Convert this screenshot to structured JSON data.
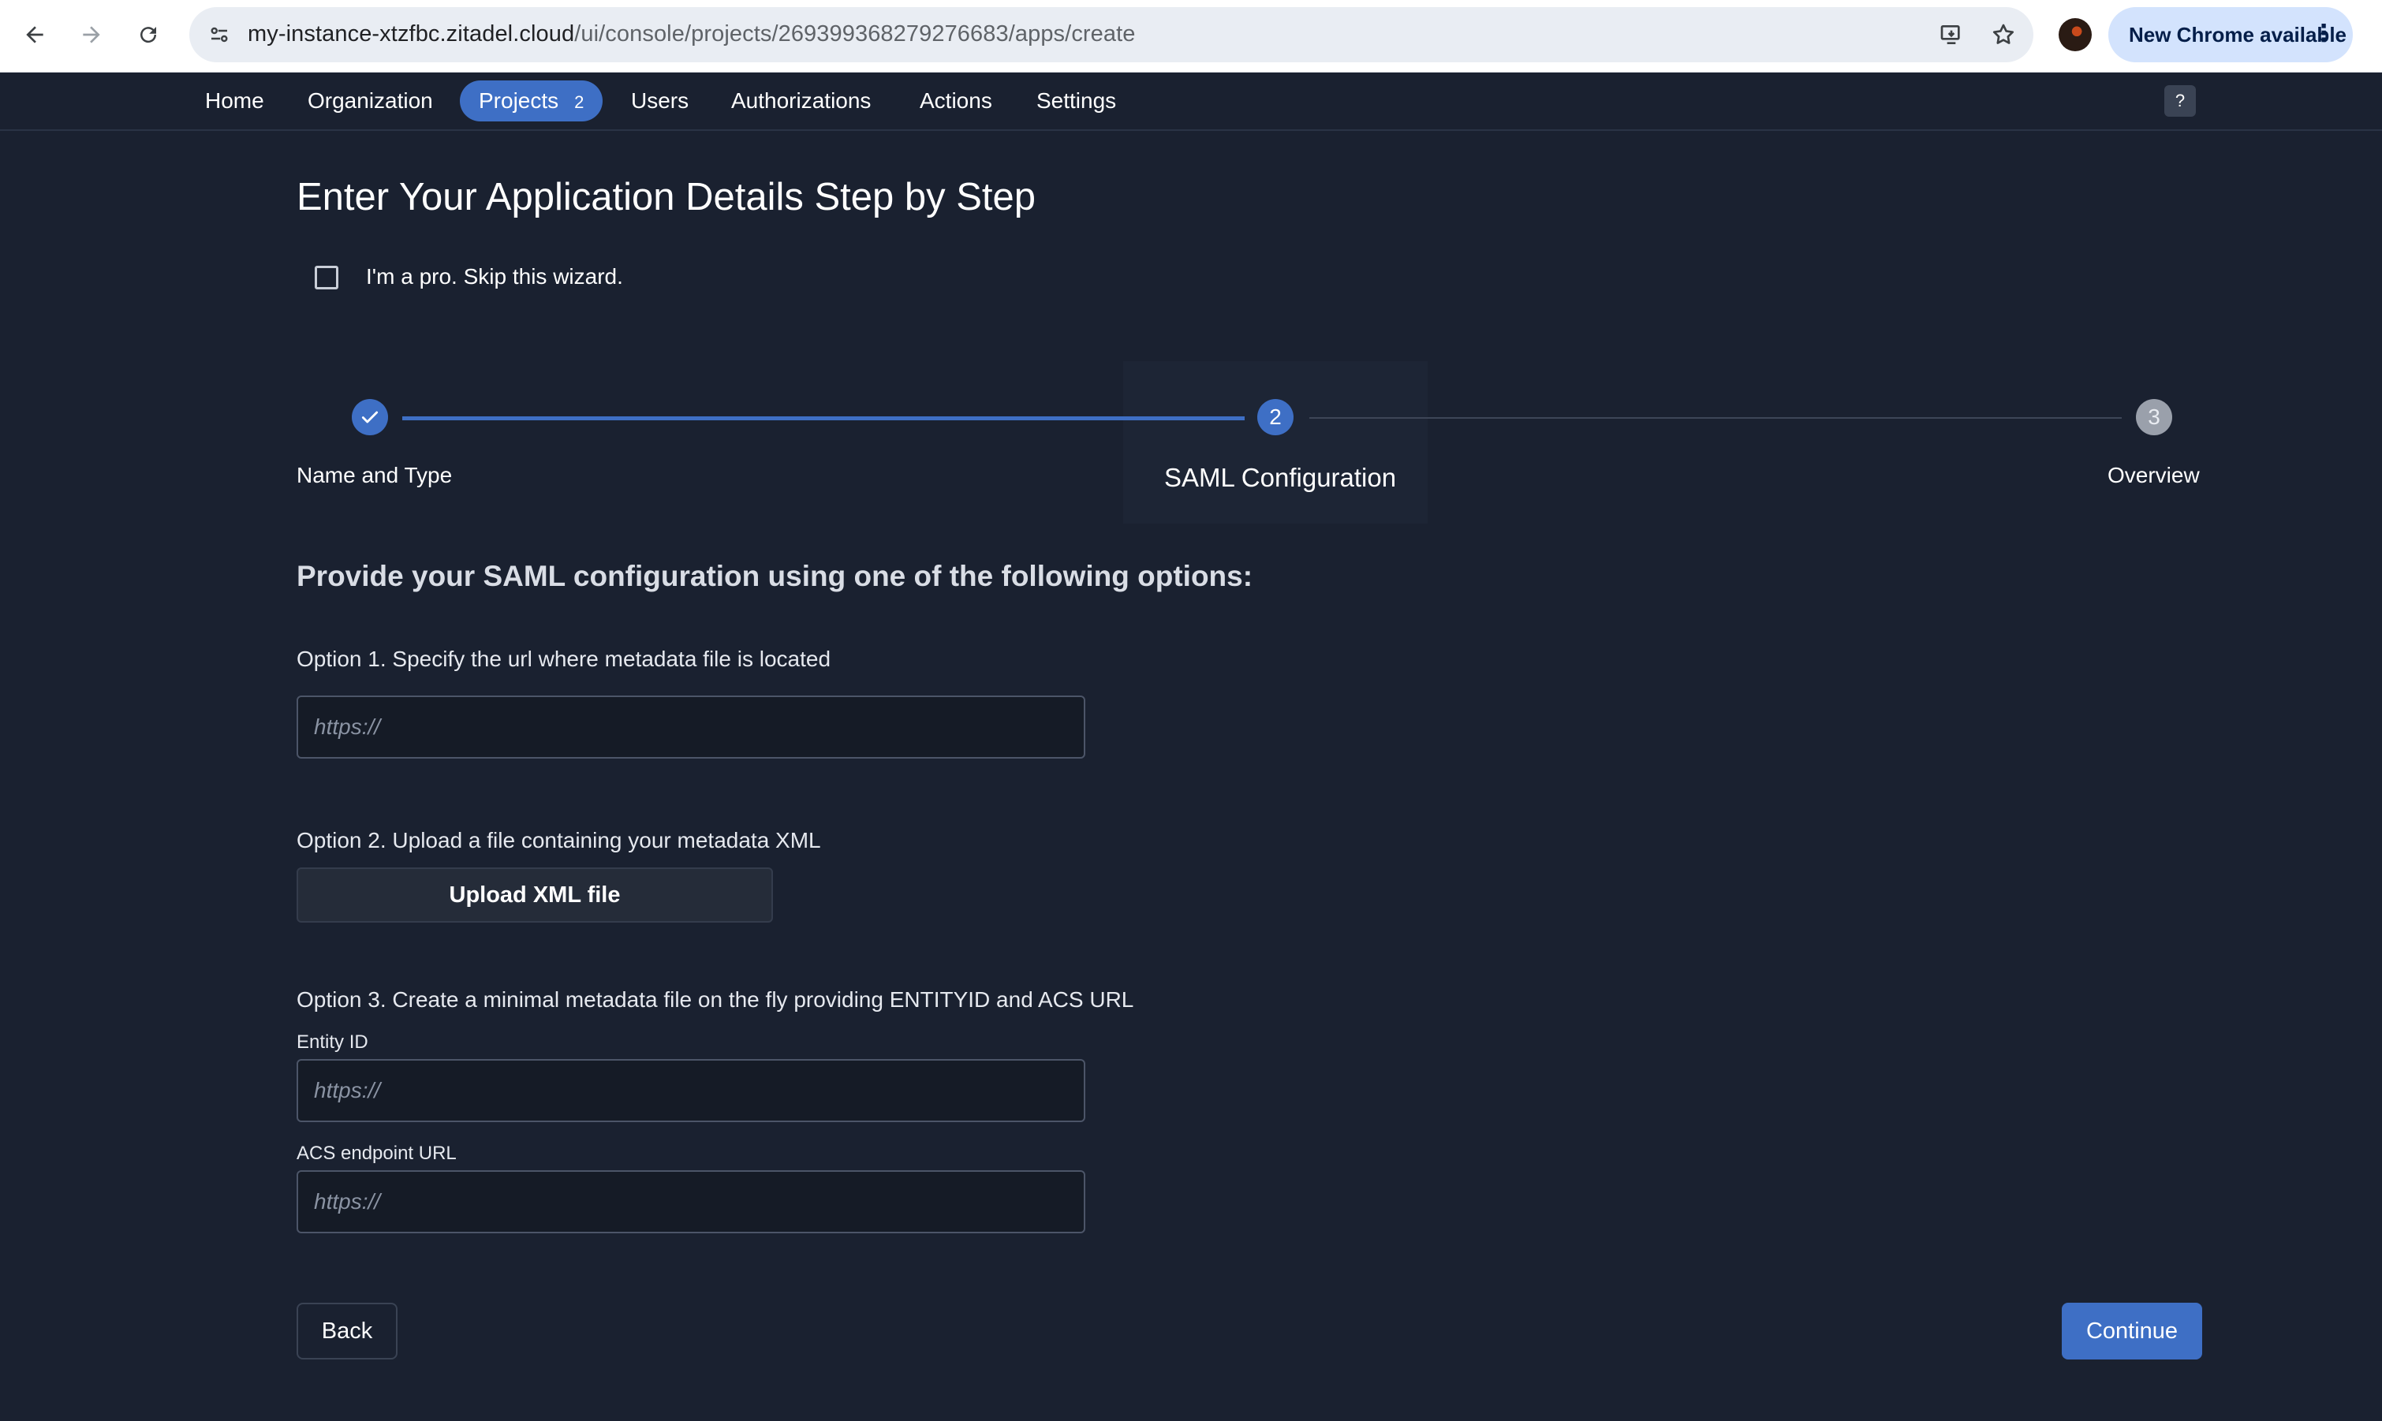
{
  "browser": {
    "url_host": "my-instance-xtzfbc.zitadel.cloud",
    "url_path": "/ui/console/projects/269399368279276683/apps/create",
    "update_label": "New Chrome available"
  },
  "nav": {
    "items": [
      "Home",
      "Organization",
      "Projects",
      "Users",
      "Authorizations",
      "Actions",
      "Settings"
    ],
    "active": "Projects",
    "projects_count": "2",
    "help_label": "?"
  },
  "page": {
    "title": "Enter Your Application Details Step by Step",
    "skip_label": "I'm a pro. Skip this wizard."
  },
  "stepper": {
    "steps": [
      {
        "number": "1",
        "label": "Name and Type",
        "state": "done"
      },
      {
        "number": "2",
        "label": "SAML Configuration",
        "state": "current"
      },
      {
        "number": "3",
        "label": "Overview",
        "state": "todo"
      }
    ]
  },
  "saml": {
    "section_title": "Provide your SAML configuration using one of the following options:",
    "option1_label": "Option 1. Specify the url where metadata file is located",
    "option1_placeholder": "https://",
    "option2_label": "Option 2. Upload a file containing your metadata XML",
    "upload_label": "Upload XML file",
    "option3_label": "Option 3. Create a minimal metadata file on the fly providing ENTITYID and ACS URL",
    "entity_id_label": "Entity ID",
    "entity_id_placeholder": "https://",
    "acs_label": "ACS endpoint URL",
    "acs_placeholder": "https://"
  },
  "actions": {
    "back_label": "Back",
    "continue_label": "Continue"
  },
  "colors": {
    "background": "#1a2130",
    "accent": "#3e6fc5"
  }
}
